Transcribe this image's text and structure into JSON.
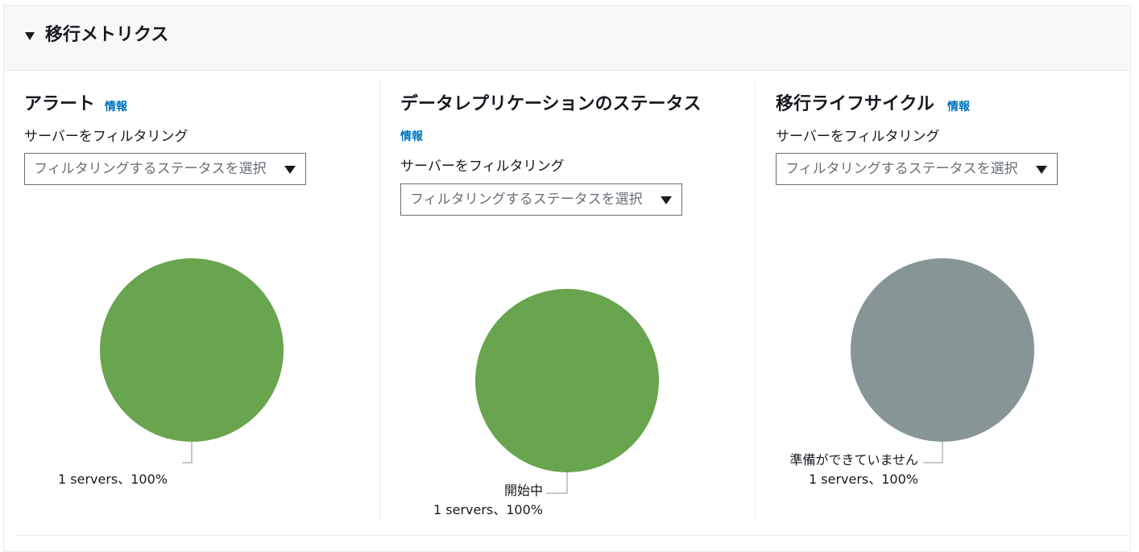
{
  "section": {
    "title": "移行メトリクス",
    "expanded": true
  },
  "info_link": "情報",
  "columns": [
    {
      "title": "アラート",
      "filter_label": "サーバーをフィルタリング",
      "filter_placeholder": "フィルタリングするステータスを選択"
    },
    {
      "title": "データレプリケーションのステータス",
      "filter_label": "サーバーをフィルタリング",
      "filter_placeholder": "フィルタリングするステータスを選択"
    },
    {
      "title": "移行ライフサイクル",
      "filter_label": "サーバーをフィルタリング",
      "filter_placeholder": "フィルタリングするステータスを選択"
    }
  ],
  "colors": {
    "green": "#69a44f",
    "gray": "#879596",
    "link": "#0073bb"
  },
  "chart_data": [
    {
      "type": "pie",
      "slices": [
        {
          "name": "",
          "value": 1,
          "percent": 100,
          "label": "1 servers、100%",
          "color": "#69a44f"
        }
      ]
    },
    {
      "type": "pie",
      "slices": [
        {
          "name": "開始中",
          "value": 1,
          "percent": 100,
          "label": "1 servers、100%",
          "color": "#69a44f"
        }
      ]
    },
    {
      "type": "pie",
      "slices": [
        {
          "name": "準備ができていません",
          "value": 1,
          "percent": 100,
          "label": "1 servers、100%",
          "color": "#879596"
        }
      ]
    }
  ]
}
